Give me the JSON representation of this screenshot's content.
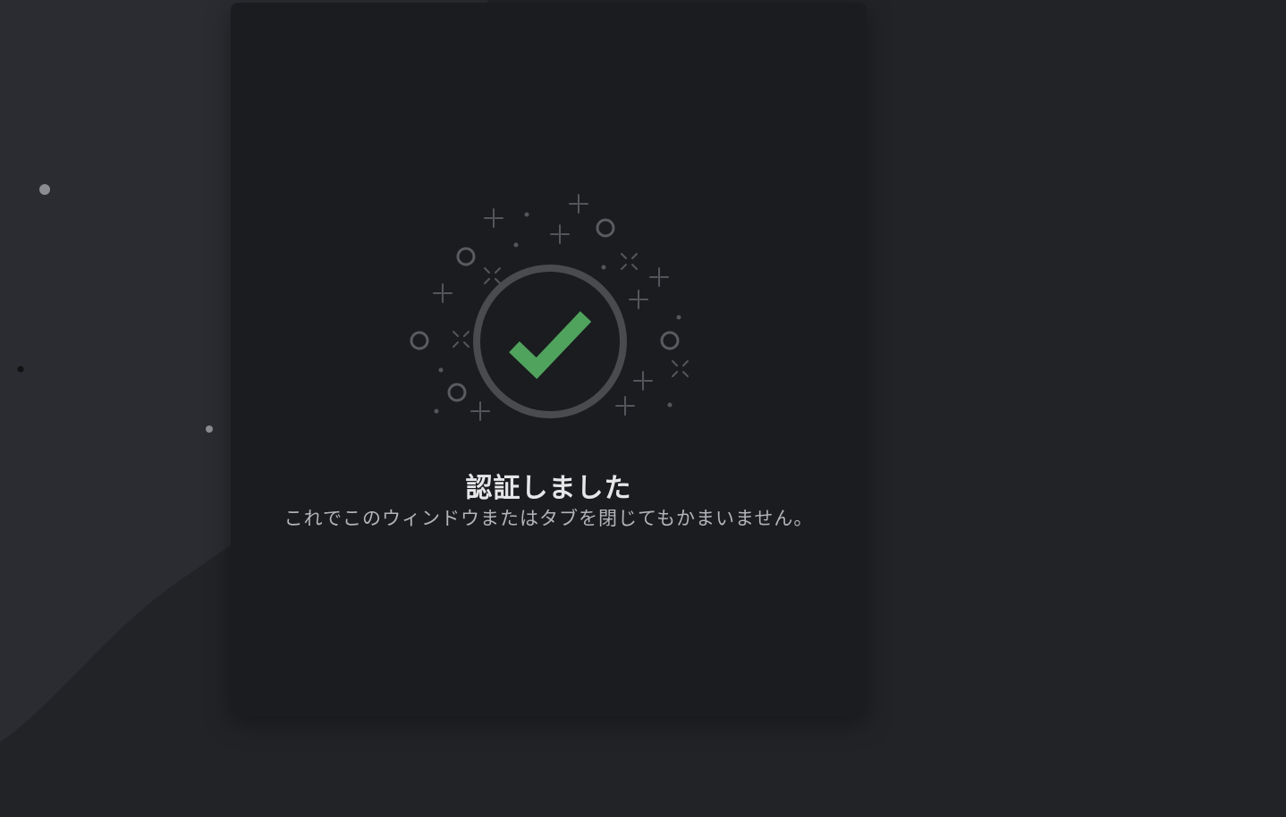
{
  "message": {
    "title": "認証しました",
    "subtitle": "これでこのウィンドウまたはタブを閉じてもかまいません。"
  },
  "colors": {
    "background": "#222327",
    "card": "#1b1c1f",
    "accent_check": "#4fa35d",
    "ring": "#4a4b4f"
  },
  "icons": {
    "status": "check-circle-icon",
    "decoration": "sparkle-icon"
  }
}
